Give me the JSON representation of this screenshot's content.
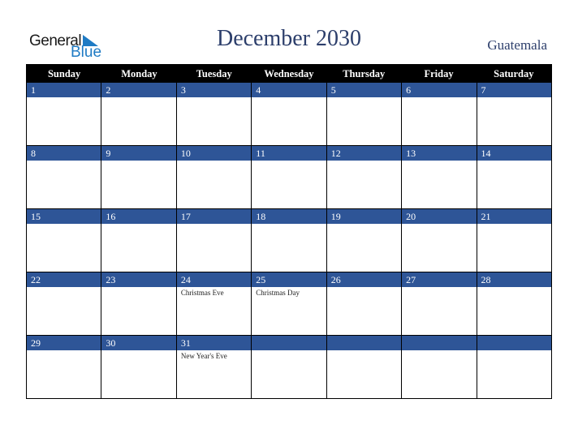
{
  "logo": {
    "general": "General",
    "blue": "Blue"
  },
  "title": "December 2030",
  "country": "Guatemala",
  "weekdays": [
    "Sunday",
    "Monday",
    "Tuesday",
    "Wednesday",
    "Thursday",
    "Friday",
    "Saturday"
  ],
  "weeks": [
    [
      {
        "d": "1"
      },
      {
        "d": "2"
      },
      {
        "d": "3"
      },
      {
        "d": "4"
      },
      {
        "d": "5"
      },
      {
        "d": "6"
      },
      {
        "d": "7"
      }
    ],
    [
      {
        "d": "8"
      },
      {
        "d": "9"
      },
      {
        "d": "10"
      },
      {
        "d": "11"
      },
      {
        "d": "12"
      },
      {
        "d": "13"
      },
      {
        "d": "14"
      }
    ],
    [
      {
        "d": "15"
      },
      {
        "d": "16"
      },
      {
        "d": "17"
      },
      {
        "d": "18"
      },
      {
        "d": "19"
      },
      {
        "d": "20"
      },
      {
        "d": "21"
      }
    ],
    [
      {
        "d": "22"
      },
      {
        "d": "23"
      },
      {
        "d": "24",
        "e": "Christmas Eve"
      },
      {
        "d": "25",
        "e": "Christmas Day"
      },
      {
        "d": "26"
      },
      {
        "d": "27"
      },
      {
        "d": "28"
      }
    ],
    [
      {
        "d": "29"
      },
      {
        "d": "30"
      },
      {
        "d": "31",
        "e": "New Year's Eve"
      },
      {
        "d": ""
      },
      {
        "d": ""
      },
      {
        "d": ""
      },
      {
        "d": ""
      }
    ]
  ]
}
